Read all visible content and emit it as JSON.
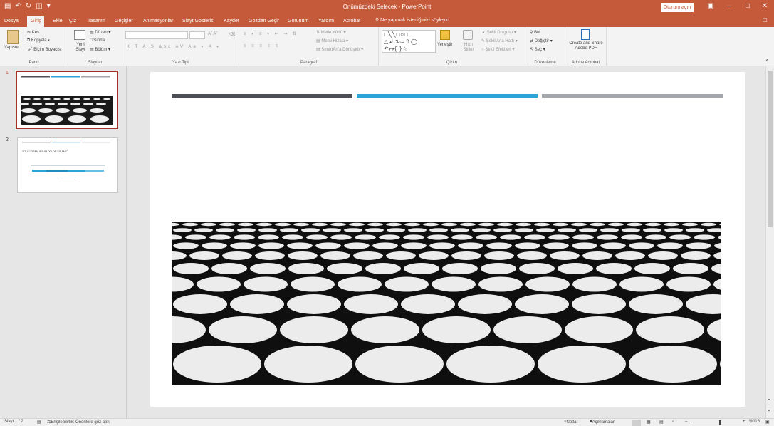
{
  "window": {
    "title": "Onümüzdeki Selecek - PowerPoint",
    "share_label": "Oturum açın"
  },
  "tabs": [
    {
      "label": "Dosya"
    },
    {
      "label": "Giriş"
    },
    {
      "label": "Ekle"
    },
    {
      "label": "Çiz"
    },
    {
      "label": "Tasarım"
    },
    {
      "label": "Geçişler"
    },
    {
      "label": "Animasyonlar"
    },
    {
      "label": "Slayt Gösterisi"
    },
    {
      "label": "Kaydet"
    },
    {
      "label": "Gözden Geçir"
    },
    {
      "label": "Görünüm"
    },
    {
      "label": "Yardım"
    },
    {
      "label": "Acrobat"
    }
  ],
  "tell_me": "Ne yapmak istediğinizi söyleyin",
  "ribbon": {
    "clipboard": {
      "paste": "Yapıştır",
      "cut": "Kes",
      "copy": "Kopyala",
      "format_painter": "Biçim Boyacısı",
      "label": "Pano"
    },
    "slides": {
      "new_slide": "Yeni Slayt",
      "layout": "Düzen",
      "reset": "Sıfırla",
      "section": "Bölüm",
      "label": "Slaytlar"
    },
    "font": {
      "label": "Yazı Tipi"
    },
    "paragraph": {
      "text_direction": "Metin Yönü",
      "align_text": "Metni Hizala",
      "smartart": "SmartArt'a Dönüştür",
      "label": "Paragraf"
    },
    "drawing": {
      "arrange": "Yerleştir",
      "quick_styles": "Hızlı Stiller",
      "shape_fill": "Şekil Dolgusu",
      "shape_outline": "Şekil Ana Hattı",
      "shape_effects": "Şekil Efektleri",
      "label": "Çizim"
    },
    "editing": {
      "find": "Bul",
      "replace": "Değiştir",
      "select": "Seç",
      "label": "Düzenleme"
    },
    "acrobat": {
      "create_share": "Create and Share Adobe PDF",
      "label": "Adobe Acrobat"
    }
  },
  "slides": [
    {
      "number": "1",
      "selected": true
    },
    {
      "number": "2",
      "selected": false,
      "thumb_title": "TITLE LOREM IPSUM DOLOR SIT AMET"
    }
  ],
  "status": {
    "slide_counter": "Slayt 1 / 2",
    "accessibility": "Erişilebilirlik: Önerilere göz atın",
    "notes": "Notlar",
    "comments": "Açıklamalar",
    "zoom": "%116"
  },
  "colors": {
    "accent": "#c55a3a",
    "bar_dark": "#4b4f55",
    "bar_blue": "#2aa3d8",
    "bar_gray": "#a3a7ab"
  }
}
